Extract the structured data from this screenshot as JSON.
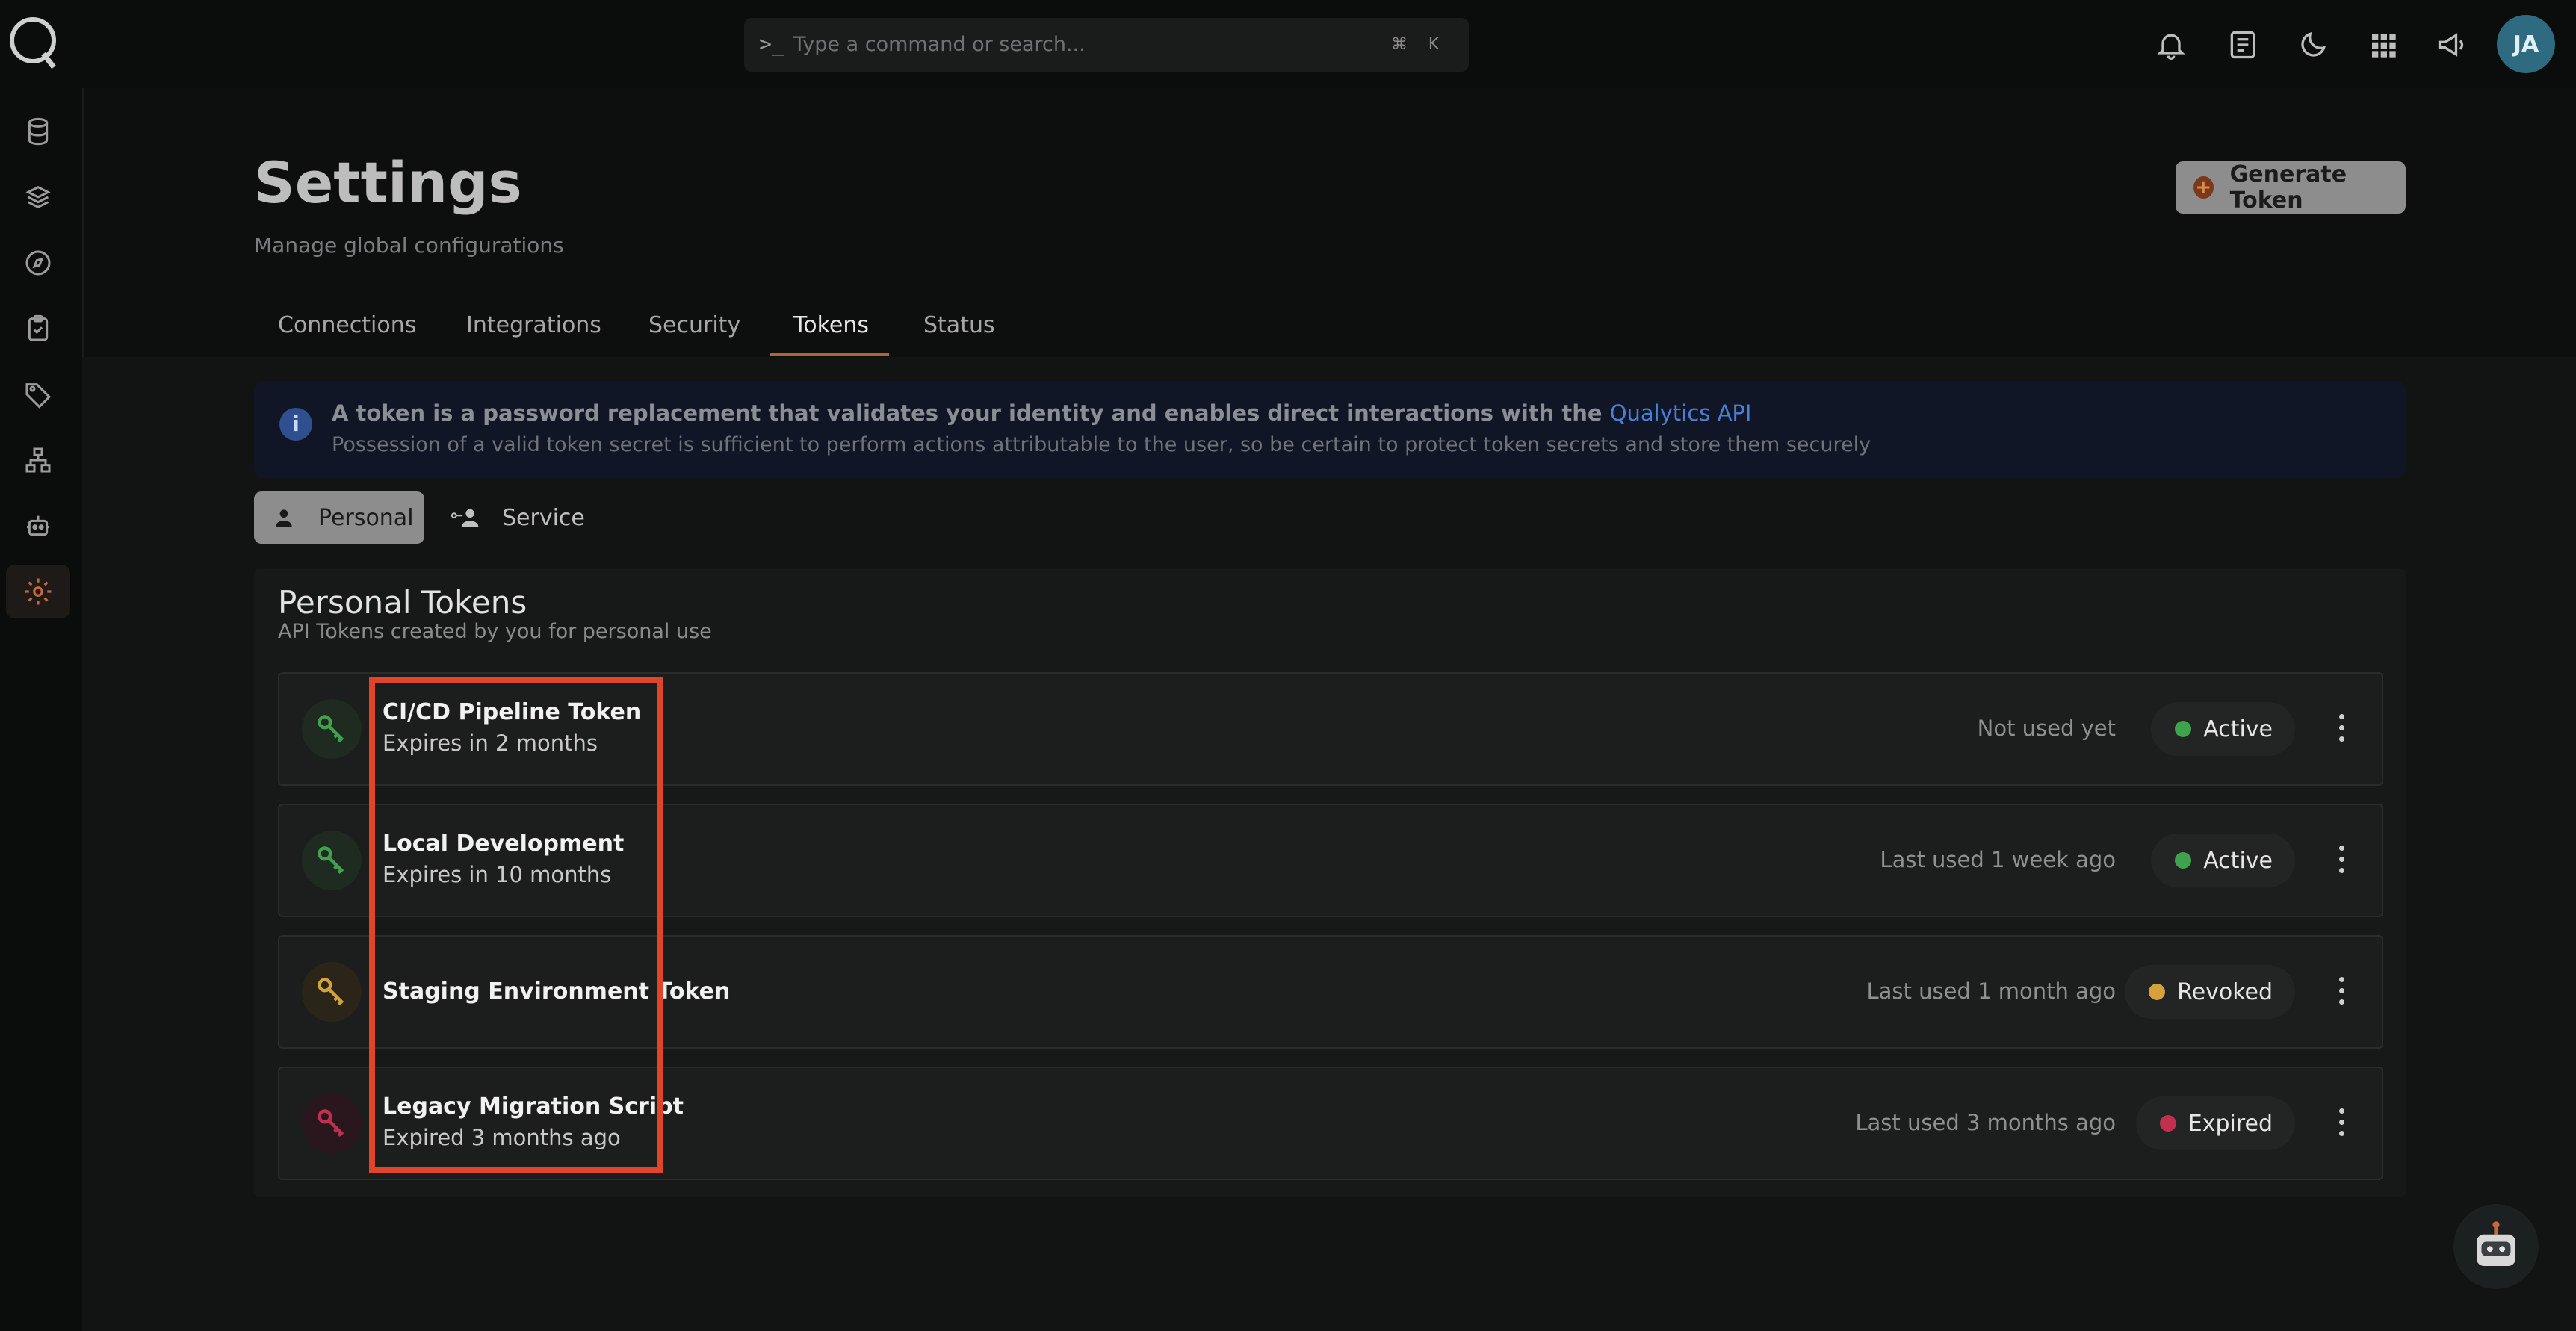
{
  "command": {
    "prompt_symbol": ">_",
    "placeholder": "Type a command or search...",
    "shortcut_mod": "⌘",
    "shortcut_key": "K"
  },
  "user": {
    "initials": "JA"
  },
  "header": {
    "title": "Settings",
    "subtitle": "Manage global configurations",
    "generate_button": "Generate Token"
  },
  "tabs": [
    "Connections",
    "Integrations",
    "Security",
    "Tokens",
    "Status"
  ],
  "active_tab": "Tokens",
  "info": {
    "line1": "A token is a password replacement that validates your identity and enables direct interactions with the",
    "link": "Qualytics API",
    "line2": "Possession of a valid token secret is sufficient to perform actions attributable to the user, so be certain to protect token secrets and store them securely"
  },
  "segments": {
    "personal": "Personal",
    "service": "Service"
  },
  "panel": {
    "title": "Personal Tokens",
    "subtitle": "API Tokens created by you for personal use"
  },
  "tokens": [
    {
      "name": "CI/CD Pipeline Token",
      "expiry": "Expires in 2 months",
      "usage": "Not used yet",
      "status": "Active",
      "color": "#3fa34d"
    },
    {
      "name": "Local Development",
      "expiry": "Expires in 10 months",
      "usage": "Last used 1 week ago",
      "status": "Active",
      "color": "#3fa34d"
    },
    {
      "name": "Staging Environment Token",
      "expiry": "",
      "usage": "Last used 1 month ago",
      "status": "Revoked",
      "color": "#d4a23a"
    },
    {
      "name": "Legacy Migration Script",
      "expiry": "Expired 3 months ago",
      "usage": "Last used 3 months ago",
      "status": "Expired",
      "color": "#c2304f"
    }
  ],
  "colors": {
    "accent": "#b3623a",
    "active": "#3fa34d",
    "revoked": "#d4a23a",
    "expired": "#c2304f",
    "link": "#4a7fd6",
    "highlight": "#e0452b"
  }
}
